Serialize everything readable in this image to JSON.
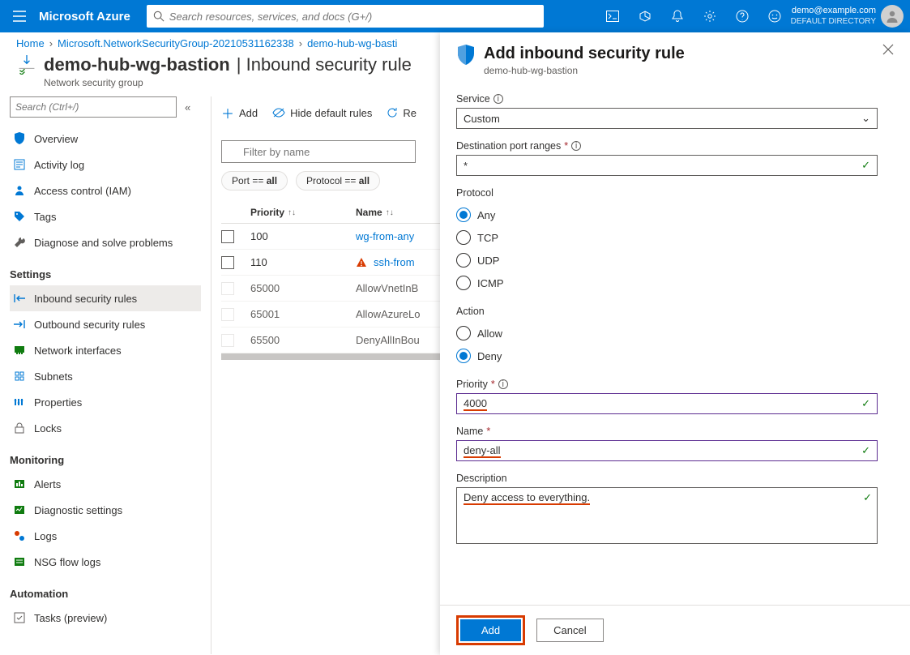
{
  "header": {
    "brand": "Microsoft Azure",
    "search_placeholder": "Search resources, services, and docs (G+/)",
    "user_email": "demo@example.com",
    "user_dir": "DEFAULT DIRECTORY"
  },
  "breadcrumb": {
    "items": [
      "Home",
      "Microsoft.NetworkSecurityGroup-20210531162338",
      "demo-hub-wg-basti"
    ]
  },
  "page": {
    "title_main": "demo-hub-wg-bastion",
    "title_sep": "|",
    "title_sub": "Inbound security rule",
    "subtitle": "Network security group"
  },
  "sidebar": {
    "search_placeholder": "Search (Ctrl+/)",
    "top_items": [
      "Overview",
      "Activity log",
      "Access control (IAM)",
      "Tags",
      "Diagnose and solve problems"
    ],
    "sections": {
      "settings": {
        "label": "Settings",
        "items": [
          "Inbound security rules",
          "Outbound security rules",
          "Network interfaces",
          "Subnets",
          "Properties",
          "Locks"
        ]
      },
      "monitoring": {
        "label": "Monitoring",
        "items": [
          "Alerts",
          "Diagnostic settings",
          "Logs",
          "NSG flow logs"
        ]
      },
      "automation": {
        "label": "Automation",
        "items": [
          "Tasks (preview)"
        ]
      }
    }
  },
  "toolbar": {
    "add": "Add",
    "hide": "Hide default rules",
    "refresh": "Re"
  },
  "filter": {
    "placeholder": "Filter by name",
    "chip_port": "Port == all",
    "chip_proto": "Protocol == all"
  },
  "table": {
    "col_priority": "Priority",
    "col_name": "Name",
    "rows": [
      {
        "priority": "100",
        "name": "wg-from-any",
        "link": true,
        "warn": false
      },
      {
        "priority": "110",
        "name": "ssh-from",
        "link": true,
        "warn": true
      },
      {
        "priority": "65000",
        "name": "AllowVnetInB",
        "link": false,
        "warn": false
      },
      {
        "priority": "65001",
        "name": "AllowAzureLo",
        "link": false,
        "warn": false
      },
      {
        "priority": "65500",
        "name": "DenyAllInBou",
        "link": false,
        "warn": false
      }
    ]
  },
  "blade": {
    "title": "Add inbound security rule",
    "subtitle": "demo-hub-wg-bastion",
    "service_label": "Service",
    "service_value": "Custom",
    "dport_label": "Destination port ranges",
    "dport_value": "*",
    "protocol_label": "Protocol",
    "protocol_options": [
      "Any",
      "TCP",
      "UDP",
      "ICMP"
    ],
    "protocol_selected": "Any",
    "action_label": "Action",
    "action_options": [
      "Allow",
      "Deny"
    ],
    "action_selected": "Deny",
    "priority_label": "Priority",
    "priority_value": "4000",
    "name_label": "Name",
    "name_value": "deny-all",
    "description_label": "Description",
    "description_value": "Deny access to everything.",
    "btn_add": "Add",
    "btn_cancel": "Cancel"
  }
}
